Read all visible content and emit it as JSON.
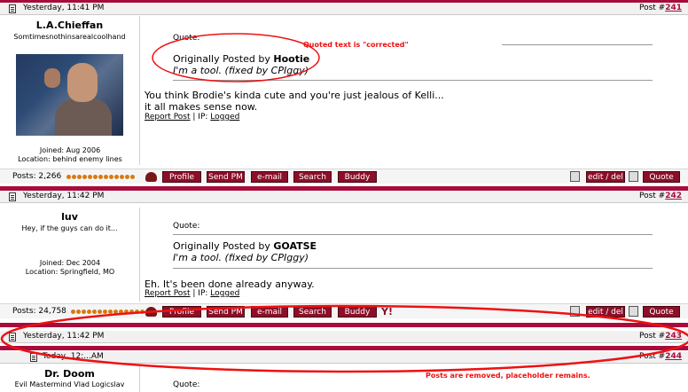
{
  "posts": [
    {
      "date": "Yesterday, 11:41 PM",
      "post_label": "Post #",
      "post_number": "241",
      "username": "L.A.Chieffan",
      "user_title": "Somtimesnothinsarealcoolhand",
      "joined": "Joined: Aug 2006",
      "location": "Location: behind enemy lines",
      "quote_label": "Quote:",
      "quote_prefix": "Originally Posted by",
      "quote_author": "Hootie",
      "quote_text": "I'm a tool. (fixed by CPIggy)",
      "body_line1": "You think Brodie's kinda cute and you're just jealous of Kelli...",
      "body_line2": "it all makes sense now.",
      "report_link": "Report Post",
      "ip_label": "| IP:",
      "ip_link": "Logged",
      "post_count": "Posts: 2,266"
    },
    {
      "date": "Yesterday, 11:42 PM",
      "post_label": "Post #",
      "post_number": "242",
      "username": "luv",
      "user_title": "Hey, if the guys can do it...",
      "joined": "Joined: Dec 2004",
      "location": "Location: Springfield, MO",
      "quote_label": "Quote:",
      "quote_prefix": "Originally Posted by",
      "quote_author": "GOATSE",
      "quote_text": "I'm a tool. (fixed by CPIggy)",
      "body_line1": "Eh. It's been done already anyway.",
      "report_link": "Report Post",
      "ip_label": "| IP:",
      "ip_link": "Logged",
      "post_count": "Posts: 24,758"
    },
    {
      "date": "Yesterday, 11:42 PM",
      "post_label": "Post #",
      "post_number": "243"
    },
    {
      "date": "Today, 12:...AM",
      "post_label": "Post #",
      "post_number": "244",
      "username": "Dr. Doom",
      "user_title": "Evil Mastermind Vlad Logicslav",
      "quote_label": "Quote:"
    }
  ],
  "buttons": {
    "profile": "Profile",
    "send_pm": "Send PM",
    "email": "e-mail",
    "search": "Search",
    "buddy": "Buddy",
    "edit_del": "edit / del",
    "quote": "Quote"
  },
  "annotations": {
    "quoted_corrected": "Quoted text is \"corrected\"",
    "posts_removed": "Posts are removed, placeholder remains."
  },
  "colors": {
    "accent": "#a80c3c",
    "button_bg": "#8b0f28",
    "annotation_red": "#ee1111"
  }
}
